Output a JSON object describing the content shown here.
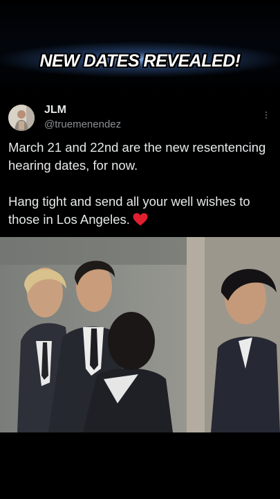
{
  "banner": {
    "headline": "NEW DATES REVEALED!"
  },
  "tweet": {
    "author": {
      "name": "JLM",
      "handle": "@truemenendez"
    },
    "line1": "March 21 and 22nd are the new resentencing hearing dates, for now.",
    "line2": "Hang tight and send all your well wishes to those in Los Angeles.",
    "emoji": "heart-icon"
  },
  "colors": {
    "background": "#000000",
    "text": "#e7e9ea",
    "handle": "#8b8f94",
    "heart": "#e0202e"
  }
}
